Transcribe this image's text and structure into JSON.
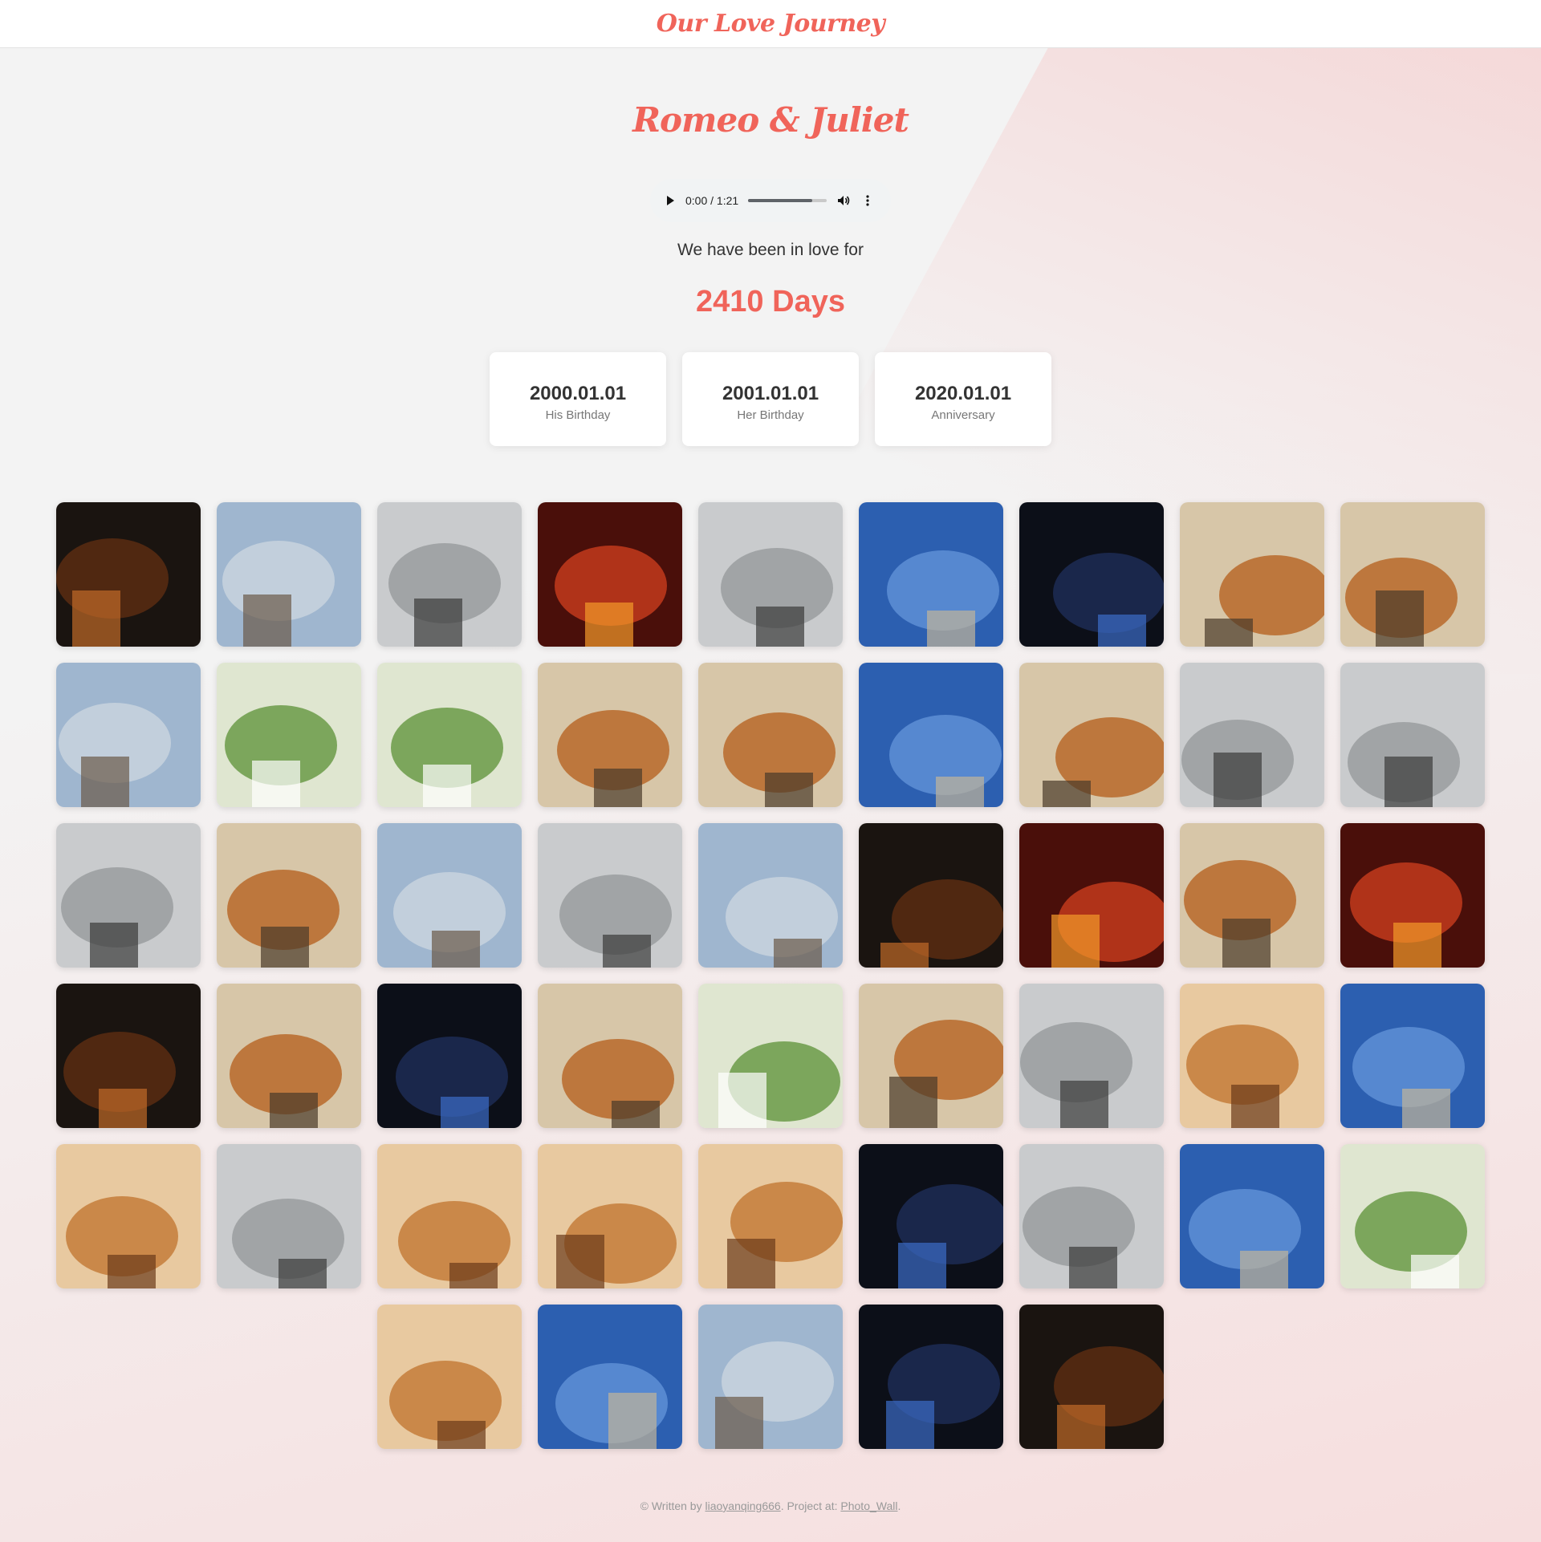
{
  "header": {
    "brand": "Our Love Journey"
  },
  "couple": {
    "names": "Romeo & Juliet"
  },
  "audio": {
    "time": "0:00 / 1:21",
    "progress": 0
  },
  "counter": {
    "intro": "We have been in love for",
    "days": "2410 Days"
  },
  "dates": [
    {
      "date": "2000.01.01",
      "label": "His Birthday"
    },
    {
      "date": "2001.01.01",
      "label": "Her Birthday"
    },
    {
      "date": "2020.01.01",
      "label": "Anniversary"
    }
  ],
  "colors": {
    "accent": "#f0645a",
    "header_bg": "#ffffff",
    "page_bg": "#f3f3f3"
  },
  "photos": [
    [
      "pagoda-night-photo",
      "chinese-gate-photo",
      "tower-bare-trees-photo",
      "ornate-gate-lanterns-photo",
      "lake-city-photo",
      "plaza-colonnade-photo",
      "night-blue-lights-photo",
      "grilled-oysters-photo",
      "claypot-dish-photo"
    ],
    [
      "river-skyline-photo",
      "city-park-lamppost-photo",
      "green-vegetables-photo",
      "fried-fish-sauce-photo",
      "roast-goose-photo",
      "autumn-lake-photo",
      "grilled-fish-sesame-photo",
      "soy-milk-bowl-photo",
      "shun-de-sign-photo"
    ],
    [
      "canton-tower-photo",
      "braised-ribs-photo",
      "riverside-skyline-photo",
      "old-street-photo",
      "plane-over-trees-photo",
      "flambe-sushi-photo",
      "sushi-plate-photo",
      "grilled-fish-plate-photo",
      "lantern-ceiling-photo"
    ],
    [
      "castle-night-photo",
      "steak-fries-photo",
      "scallops-pan-photo",
      "creamy-soup-photo",
      "salmon-greens-photo",
      "noodle-soup-photo",
      "fried-buns-photo",
      "fried-chicken-photo",
      "museum-building-photo"
    ],
    [
      "dumplings-plate-photo",
      "park-entrance-photo",
      "iced-tea-glass-photo",
      "kimchi-bowl-photo",
      "dessert-seaweed-photo",
      "river-evening-photo",
      "church-towers-photo",
      "blue-sky-night-photo",
      "rock-inscription-photo"
    ],
    [
      "hillside-town-photo",
      "ocean-waves-photo",
      "beach-city-photo",
      "river-night-photo",
      "disneyland-gate-photo"
    ]
  ],
  "footer": {
    "prefix": "© Written by ",
    "author": "liaoyanqing666",
    "middle": ". Project at: ",
    "project": "Photo_Wall",
    "suffix": "."
  }
}
